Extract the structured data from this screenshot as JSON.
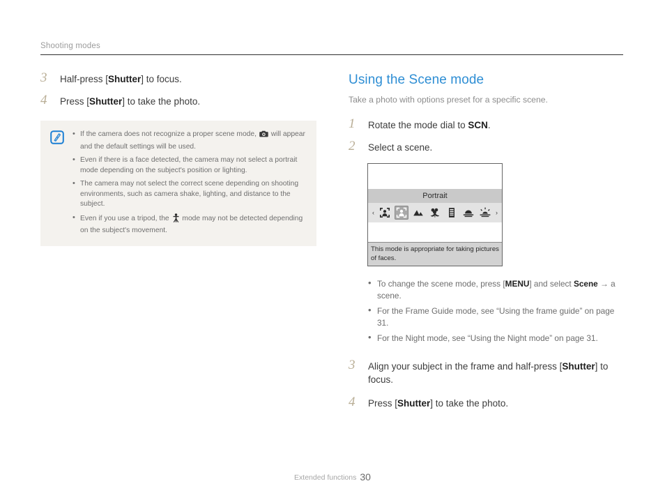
{
  "header": {
    "breadcrumb": "Shooting modes"
  },
  "left_column": {
    "steps": [
      {
        "num": "3",
        "text_before": "Half-press [",
        "bold": "Shutter",
        "text_after": "] to focus."
      },
      {
        "num": "4",
        "text_before": "Press [",
        "bold": "Shutter",
        "text_after": "] to take the photo."
      }
    ],
    "note": {
      "icon": "note-pen-icon",
      "bullets": [
        {
          "part1": "If the camera does not recognize a proper scene mode, ",
          "icon": "camera-icon",
          "part2": " will appear and the default settings will be used."
        },
        {
          "part1": "Even if there is a face detected, the camera may not select a portrait mode depending on the subject's position or lighting.",
          "icon": "",
          "part2": ""
        },
        {
          "part1": "The camera may not select the correct scene depending on shooting environments, such as camera shake, lighting, and distance to the subject.",
          "icon": "",
          "part2": ""
        },
        {
          "part1": "Even if you use a tripod, the ",
          "icon": "tripod-icon",
          "part2": " mode may not be detected depending on the subject's movement."
        }
      ]
    }
  },
  "right_column": {
    "title": "Using the Scene mode",
    "subtitle": "Take a photo with options preset for a specific scene.",
    "steps_before": [
      {
        "num": "1",
        "text_before": "Rotate the mode dial to ",
        "bold": "SCN",
        "text_after": "."
      },
      {
        "num": "2",
        "text_before": "Select a scene.",
        "bold": "",
        "text_after": ""
      }
    ],
    "camera_screen": {
      "mode_label": "Portrait",
      "left_arrow": "‹",
      "right_arrow": "›",
      "icons": [
        {
          "name": "frame-guide-icon",
          "selected": false
        },
        {
          "name": "portrait-icon",
          "selected": true
        },
        {
          "name": "landscape-icon",
          "selected": false
        },
        {
          "name": "macro-flower-icon",
          "selected": false
        },
        {
          "name": "text-document-icon",
          "selected": false
        },
        {
          "name": "sunset-icon",
          "selected": false
        },
        {
          "name": "sunrise-icon",
          "selected": false
        }
      ],
      "caption": "This mode is appropriate for taking pictures of faces."
    },
    "sub_bullets": [
      {
        "p1": "To change the scene mode, press [",
        "b1": "MENU",
        "p2": "] and select ",
        "b2": "Scene",
        "p3": " → a scene."
      },
      {
        "p1": "For the Frame Guide mode, see “Using the frame guide” on page 31.",
        "b1": "",
        "p2": "",
        "b2": "",
        "p3": ""
      },
      {
        "p1": "For the Night mode, see “Using the Night mode” on page 31.",
        "b1": "",
        "p2": "",
        "b2": "",
        "p3": ""
      }
    ],
    "steps_after": [
      {
        "num": "3",
        "text_before": "Align your subject in the frame and half-press [",
        "bold": "Shutter",
        "text_after": "] to focus."
      },
      {
        "num": "4",
        "text_before": "Press [",
        "bold": "Shutter",
        "text_after": "] to take the photo."
      }
    ]
  },
  "footer": {
    "label": "Extended functions",
    "page": "30"
  },
  "colors": {
    "accent_blue": "#2e8ed4",
    "step_number": "#b9ae96",
    "note_bg": "#f4f2ee",
    "body_text": "#3c3c3c"
  }
}
